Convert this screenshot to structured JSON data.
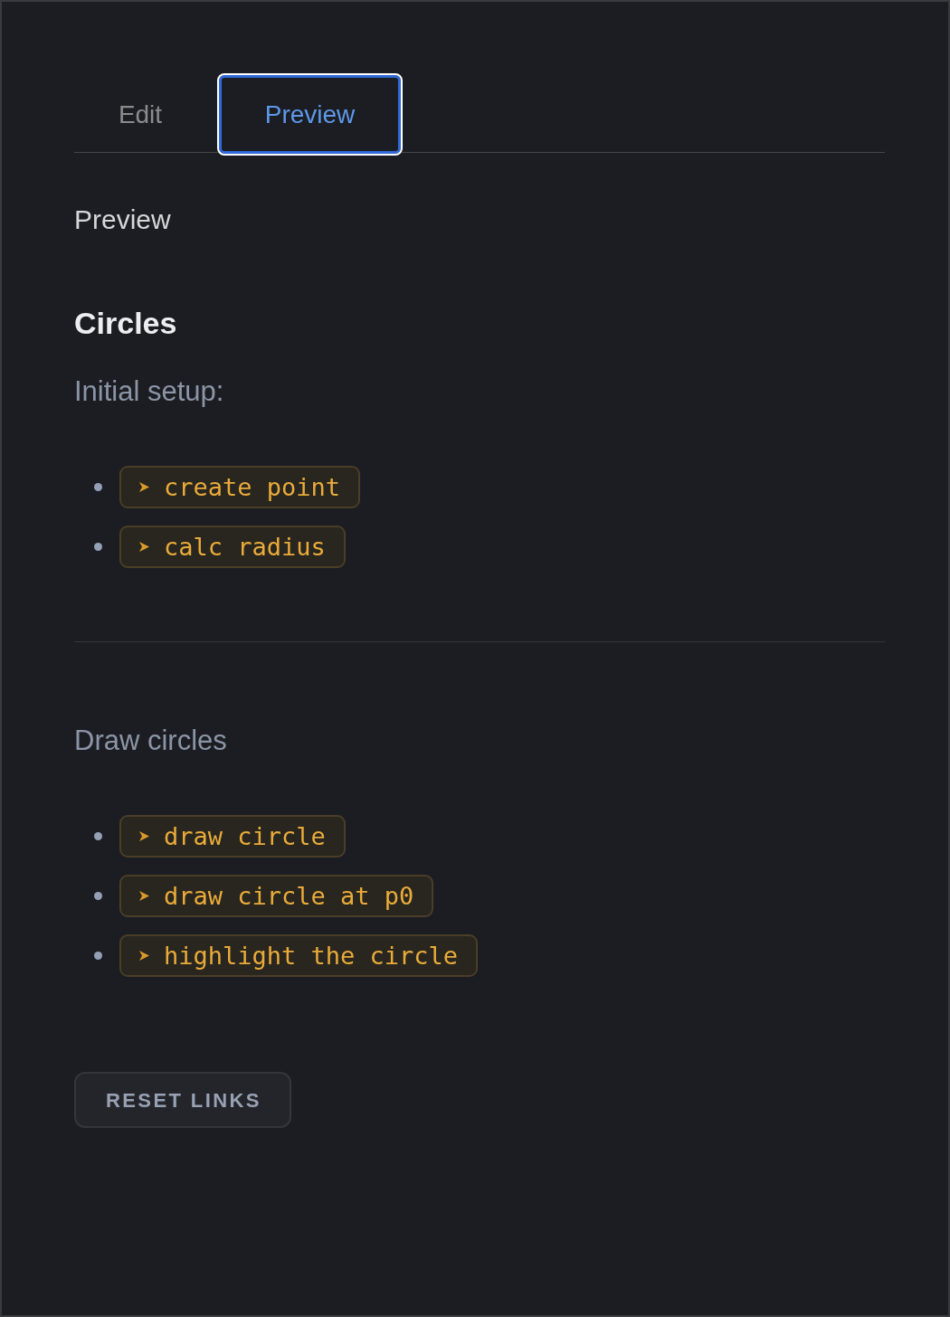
{
  "tabs": [
    {
      "label": "Edit",
      "selected": false
    },
    {
      "label": "Preview",
      "selected": true
    }
  ],
  "preview": {
    "heading": "Preview",
    "title": "Circles",
    "sections": [
      {
        "heading": "Initial setup:",
        "links": [
          "create point",
          "calc radius"
        ]
      },
      {
        "heading": "Draw circles",
        "links": [
          "draw circle",
          "draw circle at p0",
          "highlight the circle"
        ]
      }
    ]
  },
  "reset_button": "RESET LINKS"
}
